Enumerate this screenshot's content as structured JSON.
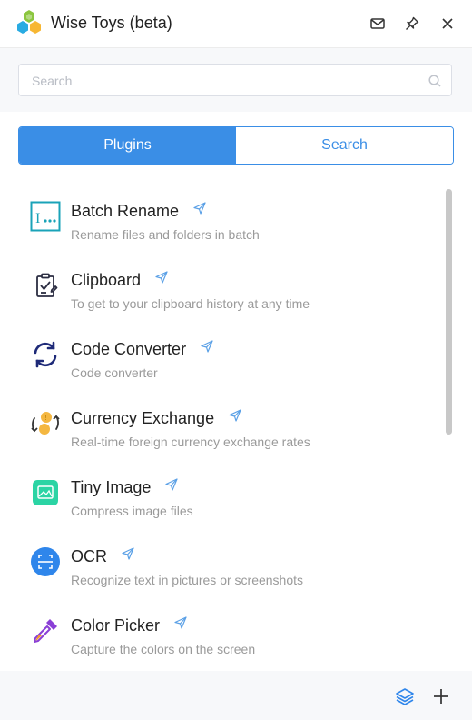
{
  "window": {
    "title": "Wise Toys (beta)",
    "logo_icon": "hexagon-cluster-icon",
    "buttons": [
      "mail-icon",
      "pin-icon",
      "close-icon"
    ]
  },
  "search": {
    "placeholder": "Search",
    "value": "",
    "icon": "search-icon"
  },
  "tabs": [
    {
      "label": "Plugins",
      "active": true
    },
    {
      "label": "Search",
      "active": false
    }
  ],
  "plugins": [
    {
      "title": "Batch Rename",
      "description": "Rename files and folders in batch",
      "icon": "batch-rename-icon",
      "accent": "#1aa3b8"
    },
    {
      "title": "Clipboard",
      "description": "To get to your clipboard history at any time",
      "icon": "clipboard-icon",
      "accent": "#2b2d42"
    },
    {
      "title": "Code Converter",
      "description": "Code converter",
      "icon": "code-converter-icon",
      "accent": "#1e2a78"
    },
    {
      "title": "Currency Exchange",
      "description": "Real-time foreign currency exchange rates",
      "icon": "currency-exchange-icon",
      "accent": "#f4b740"
    },
    {
      "title": "Tiny Image",
      "description": "Compress image files",
      "icon": "tiny-image-icon",
      "accent": "#2bd4a4"
    },
    {
      "title": "OCR",
      "description": "Recognize text in pictures or screenshots",
      "icon": "ocr-icon",
      "accent": "#2f86eb"
    },
    {
      "title": "Color Picker",
      "description": "Capture the colors on the screen",
      "icon": "color-picker-icon",
      "accent": "#8a3fd6"
    }
  ],
  "footer": {
    "buttons": [
      "layers-icon",
      "add-icon"
    ]
  },
  "colors": {
    "primary": "#3a8ee6",
    "send_icon": "#5aa0e6",
    "description_text": "#9a9a9a"
  }
}
